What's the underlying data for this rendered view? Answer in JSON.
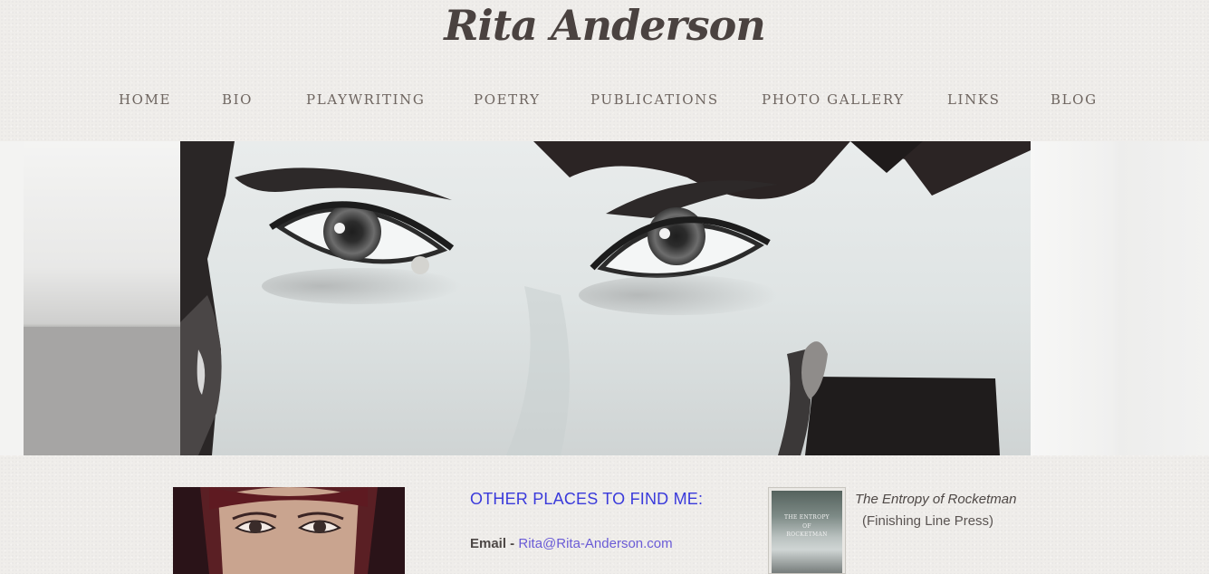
{
  "site": {
    "title": "Rita Anderson"
  },
  "nav": {
    "items": [
      {
        "label": "HOME"
      },
      {
        "label": "BIO"
      },
      {
        "label": "PLAYWRITING"
      },
      {
        "label": "POETRY"
      },
      {
        "label": "PUBLICATIONS"
      },
      {
        "label": "PHOTO GALLERY"
      },
      {
        "label": "LINKS"
      },
      {
        "label": "BLOG"
      }
    ]
  },
  "contact": {
    "heading": "OTHER PLACES TO FIND ME:",
    "email_label": "Email - ",
    "email_value": "Rita@Rita-Anderson.com"
  },
  "book": {
    "cover_line1": "THE ENTROPY",
    "cover_line2": "OF",
    "cover_line3": "ROCKETMAN",
    "title": "The Entropy of Rocketman",
    "publisher": "(Finishing Line Press)"
  },
  "colors": {
    "background": "#efedea",
    "title": "#4a4240",
    "nav_text": "#6e6560",
    "heading_blue": "#3a3adb",
    "link": "#6a5bd6"
  }
}
